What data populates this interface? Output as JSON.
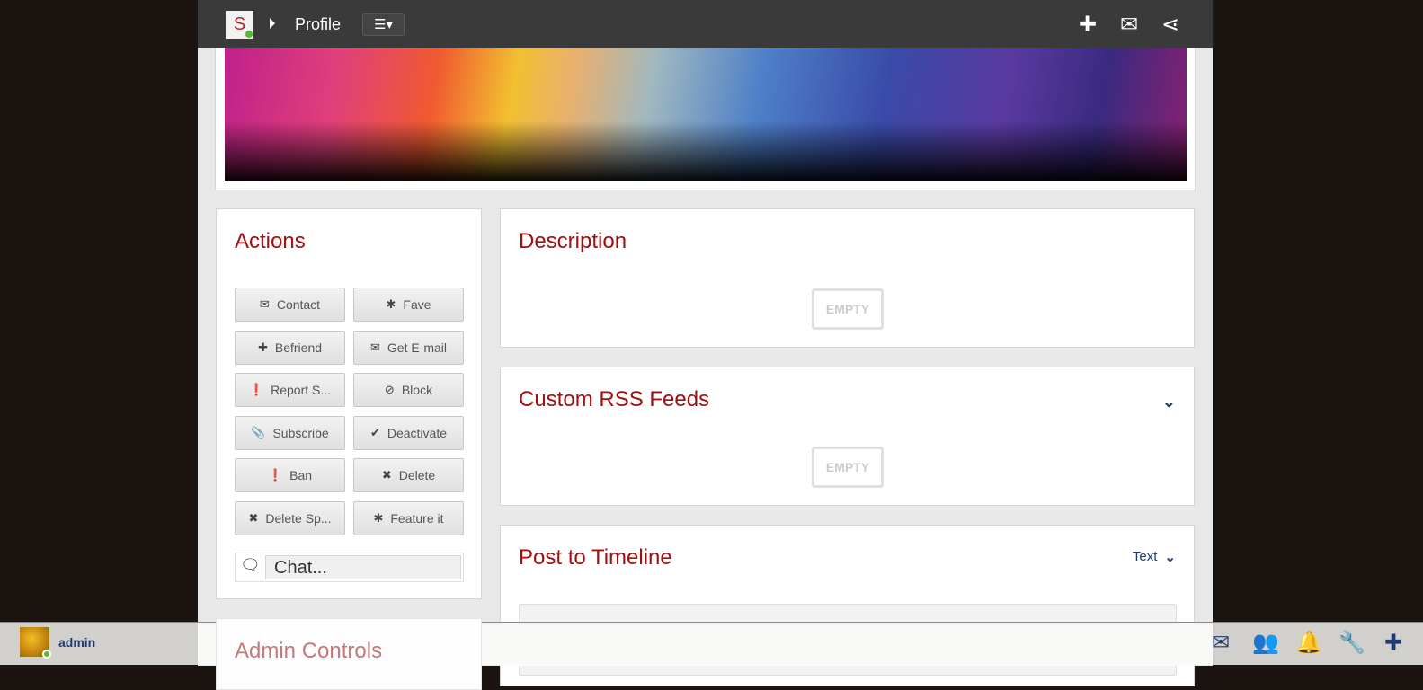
{
  "header": {
    "logo_letter": "S",
    "title": "Profile",
    "menu_icon": "☰▾",
    "icons": [
      "plus-icon",
      "envelope-icon",
      "share-icon"
    ]
  },
  "actions": {
    "title": "Actions",
    "buttons": [
      {
        "label": "Contact",
        "icon": "✉"
      },
      {
        "label": "Fave",
        "icon": "✱"
      },
      {
        "label": "Befriend",
        "icon": "✚"
      },
      {
        "label": "Get E-mail",
        "icon": "✉"
      },
      {
        "label": "Report S...",
        "icon": "❗"
      },
      {
        "label": "Block",
        "icon": "⊘"
      },
      {
        "label": "Subscribe",
        "icon": "📎"
      },
      {
        "label": "Deactivate",
        "icon": "✔"
      },
      {
        "label": "Ban",
        "icon": "❗"
      },
      {
        "label": "Delete",
        "icon": "✖"
      },
      {
        "label": "Delete Sp...",
        "icon": "✖"
      },
      {
        "label": "Feature it",
        "icon": "✱"
      }
    ],
    "chat_placeholder": "Chat..."
  },
  "description": {
    "title": "Description",
    "empty": "EMPTY"
  },
  "rss": {
    "title": "Custom RSS Feeds",
    "empty": "EMPTY"
  },
  "timeline": {
    "title": "Post to Timeline",
    "type": "Text"
  },
  "admin_controls": {
    "title": "Admin Controls"
  },
  "bottom": {
    "username": "admin"
  },
  "colors": {
    "accent": "#a01010",
    "nav": "#1e3a6e",
    "topbar": "#3a3a3a"
  }
}
